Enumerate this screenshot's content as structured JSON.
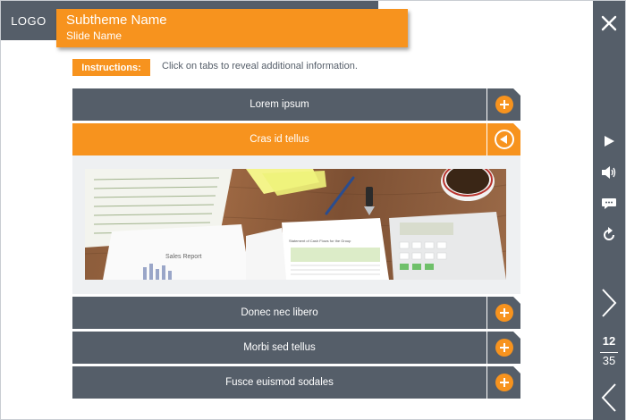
{
  "header": {
    "logo": "LOGO",
    "subtheme": "Subtheme Name",
    "slide_name": "Slide Name"
  },
  "instructions": {
    "label": "Instructions:",
    "text": "Click on tabs to reveal additional information."
  },
  "tabs": [
    {
      "label": "Lorem ipsum",
      "state": "collapsed"
    },
    {
      "label": "Cras id tellus",
      "state": "expanded"
    },
    {
      "label": "Donec nec libero",
      "state": "collapsed"
    },
    {
      "label": "Morbi sed tellus",
      "state": "collapsed"
    },
    {
      "label": "Fusce euismod sodales",
      "state": "collapsed"
    }
  ],
  "photo": {
    "report_title": "Sales Report",
    "doc_heading": "Statement of Cash Flows for the Group"
  },
  "sidebar": {
    "icons": [
      "close-icon",
      "play-icon",
      "volume-icon",
      "comment-icon",
      "replay-icon",
      "next-icon",
      "prev-icon"
    ],
    "page_current": "12",
    "page_total": "35"
  },
  "colors": {
    "accent": "#f7931e",
    "dark": "#555e69",
    "white": "#ffffff"
  }
}
